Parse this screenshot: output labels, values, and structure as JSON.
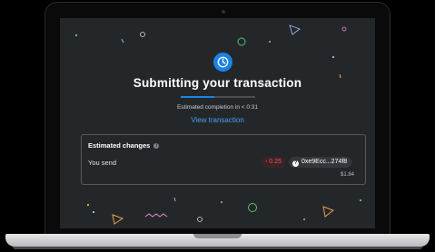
{
  "transaction": {
    "title": "Submitting your transaction",
    "estimated_completion": "Estimated completion in < 0:31",
    "view_link": "View transaction",
    "progress_percent": 45
  },
  "changes": {
    "title": "Estimated changes",
    "send_label": "You send",
    "amount": "- 0.25",
    "token_address": "0xe9Ecc...274f8",
    "token_icon_symbol": "?",
    "fiat_value": "$1.84"
  },
  "info_icon_symbol": "i",
  "colors": {
    "accent": "#1c82e4",
    "link": "#4a9df5",
    "negative": "#e05d5d",
    "screen_background": "#24272a"
  },
  "icons": [
    "clock-icon",
    "info-icon",
    "token-icon"
  ]
}
